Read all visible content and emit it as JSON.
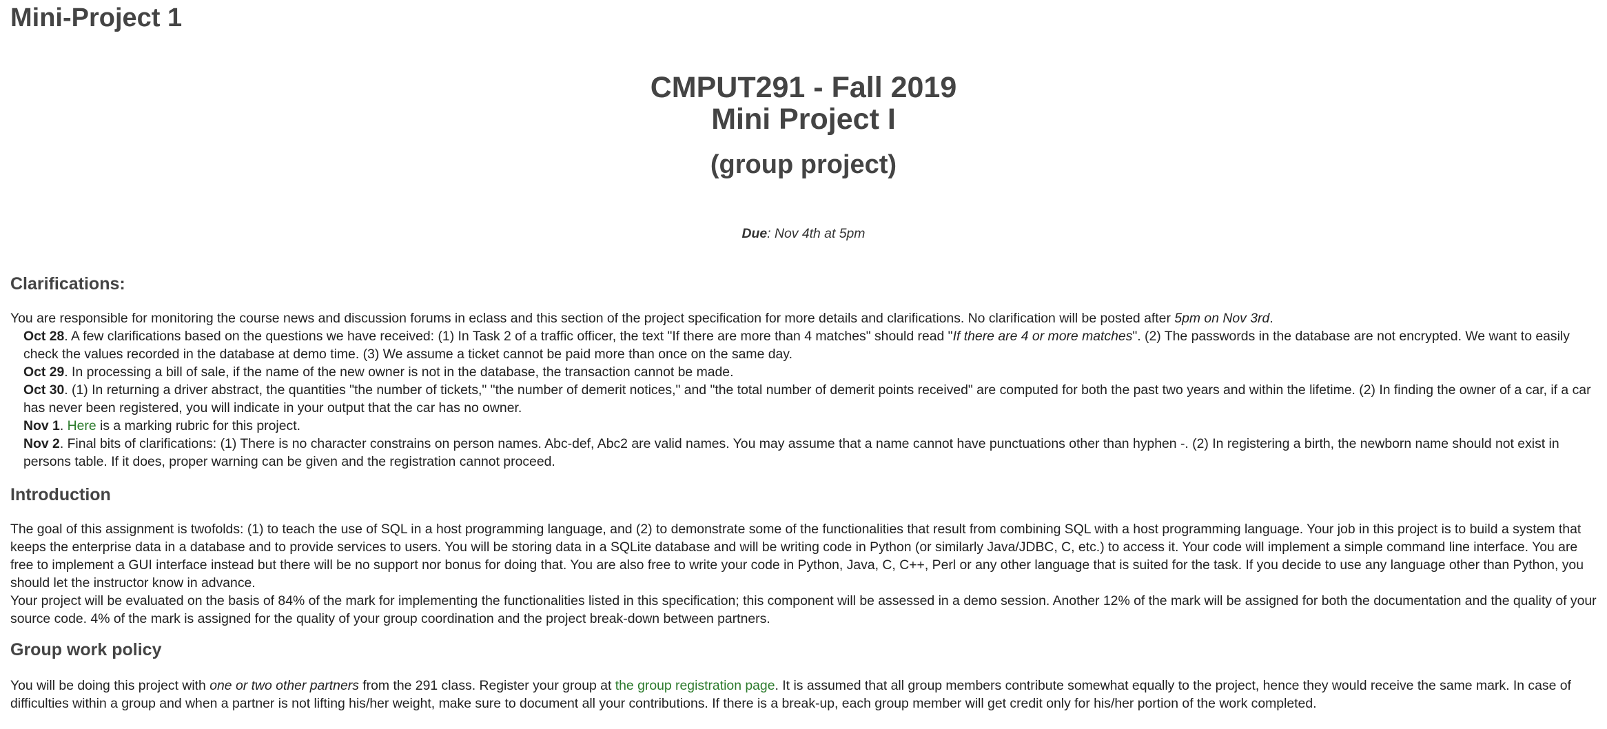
{
  "page_title": "Mini-Project 1",
  "hero": {
    "course": "CMPUT291 - Fall 2019",
    "project": "Mini Project I",
    "type": "(group project)"
  },
  "due": {
    "label": "Due",
    "text": ": Nov 4th at 5pm"
  },
  "clarifications": {
    "heading": "Clarifications:",
    "intro_text": "You are responsible for monitoring the course news and discussion forums in eclass and this section of the project specification for more details and clarifications. No clarification will be posted after ",
    "intro_deadline": "5pm on Nov 3rd",
    "intro_end": ".",
    "items": [
      {
        "date": "Oct 28",
        "text_1": ". A few clarifications based on the questions we have received: (1) In Task 2 of a traffic officer, the text \"If there are more than 4 matches\" should read \"",
        "italic": "If there are 4 or more matches",
        "text_2": "\". (2) The passwords in the database are not encrypted. We want to easily check the values recorded in the database at demo time. (3) We assume a ticket cannot be paid more than once on the same day."
      },
      {
        "date": "Oct 29",
        "text_1": ". In processing a bill of sale, if the name of the new owner is not in the database, the transaction cannot be made."
      },
      {
        "date": "Oct 30",
        "text_1": ". (1) In returning a driver abstract, the quantities \"the number of tickets,\" \"the number of demerit notices,\" and \"the total number of demerit points received\" are computed for both the past two years and within the lifetime. (2) In finding the owner of a car, if a car has never been registered, you will indicate in your output that the car has no owner."
      },
      {
        "date": "Nov 1",
        "text_1": ". ",
        "link": "Here",
        "text_2": " is a marking rubric for this project."
      },
      {
        "date": "Nov 2",
        "text_1": ". Final bits of clarifications: (1) There is no character constrains on person names. Abc-def, Abc2 are valid names. You may assume that a name cannot have punctuations other than hyphen -. (2) In registering a birth, the newborn name should not exist in persons table. If it does, proper warning can be given and the registration cannot proceed."
      }
    ]
  },
  "introduction": {
    "heading": "Introduction",
    "paragraph_1": "The goal of this assignment is twofolds: (1) to teach the use of SQL in a host programming language, and (2) to demonstrate some of the functionalities that result from combining SQL with a host programming language. Your job in this project is to build a system that keeps the enterprise data in a database and to provide services to users. You will be storing data in a SQLite database and will be writing code in Python (or similarly Java/JDBC, C, etc.) to access it. Your code will implement a simple command line interface. You are free to implement a GUI interface instead but there will be no support nor bonus for doing that. You are also free to write your code in Python, Java, C, C++, Perl or any other language that is suited for the task. If you decide to use any language other than Python, you should let the instructor know in advance.",
    "paragraph_2": "Your project will be evaluated on the basis of 84% of the mark for implementing the functionalities listed in this specification; this component will be assessed in a demo session. Another 12% of the mark will be assigned for both the documentation and the quality of your source code. 4% of the mark is assigned for the quality of your group coordination and the project break-down between partners."
  },
  "group_work": {
    "heading": "Group work policy",
    "text_1": "You will be doing this project with ",
    "italic": "one or two other partners",
    "text_2": " from the 291 class. Register your group at ",
    "link": "the group registration page",
    "text_3": ". It is assumed that all group members contribute somewhat equally to the project, hence they would receive the same mark. In case of difficulties within a group and when a partner is not lifting his/her weight, make sure to document all your contributions. If there is a break-up, each group member will get credit only for his/her portion of the work completed."
  },
  "colors": {
    "heading": "#444444",
    "body_text": "#222222",
    "link": "#2b7a2b",
    "background": "#ffffff"
  }
}
